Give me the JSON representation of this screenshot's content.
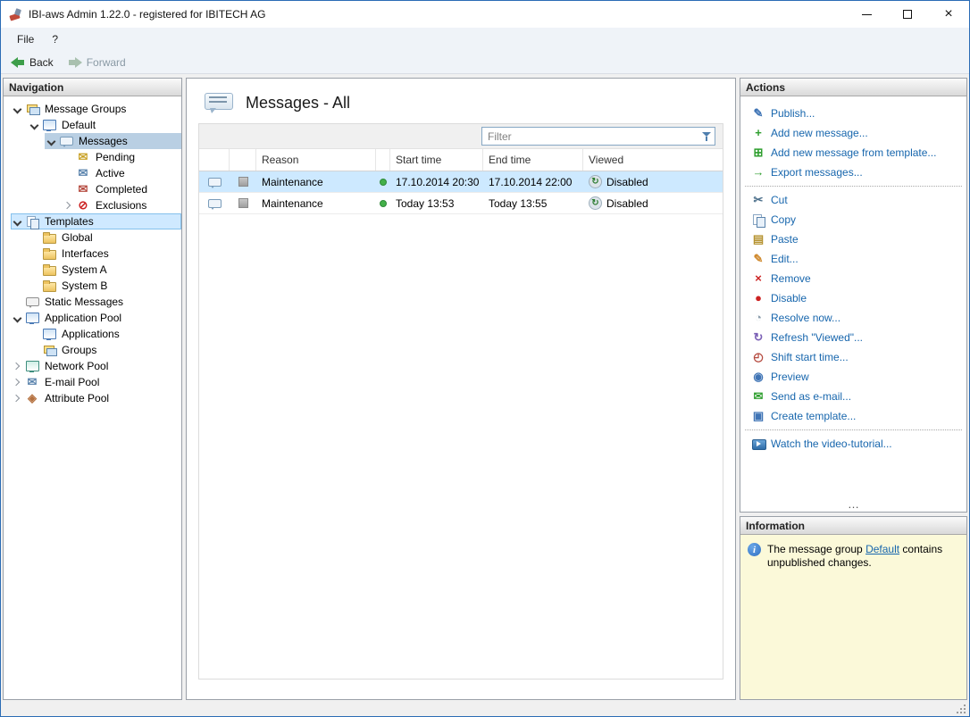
{
  "window": {
    "title": "IBI-aws Admin 1.22.0 - registered for IBITECH AG"
  },
  "menubar": {
    "file": "File",
    "help": "?"
  },
  "toolbar": {
    "back_label": "Back",
    "forward_label": "Forward"
  },
  "navigation": {
    "header": "Navigation",
    "tree": [
      {
        "label": "Message Groups",
        "level": 0,
        "icon": "message-groups-icon",
        "chevron": "expanded",
        "state": "none"
      },
      {
        "label": "Default",
        "level": 1,
        "icon": "default-group-icon",
        "chevron": "expanded",
        "state": "none"
      },
      {
        "label": "Messages",
        "level": 2,
        "icon": "messages-icon",
        "chevron": "expanded",
        "state": "selected"
      },
      {
        "label": "Pending",
        "level": 3,
        "icon": "pending-icon",
        "chevron": "none",
        "state": "none"
      },
      {
        "label": "Active",
        "level": 3,
        "icon": "active-icon",
        "chevron": "none",
        "state": "none"
      },
      {
        "label": "Completed",
        "level": 3,
        "icon": "completed-icon",
        "chevron": "none",
        "state": "none"
      },
      {
        "label": "Exclusions",
        "level": 3,
        "icon": "exclusions-icon",
        "chevron": "collapsed",
        "state": "none"
      },
      {
        "label": "Templates",
        "level": 0,
        "icon": "templates-icon",
        "chevron": "expanded",
        "state": "highlighted"
      },
      {
        "label": "Global",
        "level": 1,
        "icon": "folder-icon",
        "chevron": "none",
        "state": "none"
      },
      {
        "label": "Interfaces",
        "level": 1,
        "icon": "folder-icon",
        "chevron": "none",
        "state": "none"
      },
      {
        "label": "System A",
        "level": 1,
        "icon": "folder-icon",
        "chevron": "none",
        "state": "none"
      },
      {
        "label": "System B",
        "level": 1,
        "icon": "folder-icon",
        "chevron": "none",
        "state": "none"
      },
      {
        "label": "Static Messages",
        "level": 0,
        "icon": "static-messages-icon",
        "chevron": "none",
        "state": "none"
      },
      {
        "label": "Application Pool",
        "level": 0,
        "icon": "application-pool-icon",
        "chevron": "expanded",
        "state": "none"
      },
      {
        "label": "Applications",
        "level": 1,
        "icon": "applications-icon",
        "chevron": "none",
        "state": "none"
      },
      {
        "label": "Groups",
        "level": 1,
        "icon": "groups-icon",
        "chevron": "none",
        "state": "none"
      },
      {
        "label": "Network Pool",
        "level": 0,
        "icon": "network-pool-icon",
        "chevron": "collapsed",
        "state": "none"
      },
      {
        "label": "E-mail Pool",
        "level": 0,
        "icon": "email-pool-icon",
        "chevron": "collapsed",
        "state": "none"
      },
      {
        "label": "Attribute Pool",
        "level": 0,
        "icon": "attribute-pool-icon",
        "chevron": "collapsed",
        "state": "none"
      }
    ]
  },
  "main": {
    "title": "Messages - All",
    "filter": {
      "placeholder": "Filter"
    },
    "table": {
      "columns": [
        "",
        "",
        "Reason",
        "",
        "Start time",
        "End time",
        "Viewed"
      ],
      "rows": [
        {
          "reason": "Maintenance",
          "start": "17.10.2014 20:30",
          "end": "17.10.2014 22:00",
          "viewed": "Disabled",
          "selected": true
        },
        {
          "reason": "Maintenance",
          "start": "Today 13:53",
          "end": "Today 13:55",
          "viewed": "Disabled",
          "selected": false
        }
      ]
    }
  },
  "actions": {
    "header": "Actions",
    "overflow": "…",
    "items": [
      {
        "label": "Publish...",
        "icon": "publish-icon"
      },
      {
        "label": "Add new message...",
        "icon": "add-message-icon"
      },
      {
        "label": "Add new message from template...",
        "icon": "add-from-template-icon"
      },
      {
        "label": "Export messages...",
        "icon": "export-icon"
      },
      {
        "label": "Cut",
        "icon": "cut-icon",
        "separator_before": true
      },
      {
        "label": "Copy",
        "icon": "copy-icon"
      },
      {
        "label": "Paste",
        "icon": "paste-icon"
      },
      {
        "label": "Edit...",
        "icon": "edit-icon"
      },
      {
        "label": "Remove",
        "icon": "remove-icon"
      },
      {
        "label": "Disable",
        "icon": "disable-icon"
      },
      {
        "label": "Resolve now...",
        "icon": "resolve-icon"
      },
      {
        "label": "Refresh \"Viewed\"...",
        "icon": "refresh-viewed-icon"
      },
      {
        "label": "Shift start time...",
        "icon": "shift-start-icon"
      },
      {
        "label": "Preview",
        "icon": "preview-icon"
      },
      {
        "label": "Send as e-mail...",
        "icon": "send-email-icon"
      },
      {
        "label": "Create template...",
        "icon": "create-template-icon"
      },
      {
        "label": "Watch the video-tutorial...",
        "icon": "video-tutorial-icon",
        "separator_before": true
      }
    ]
  },
  "information": {
    "header": "Information",
    "text_before": "The message group ",
    "link": "Default",
    "text_after": " contains unpublished changes."
  },
  "icons": {
    "close-icon": {
      "glyph": "×"
    },
    "info-icon": {
      "glyph": "i"
    },
    "pending-icon": {
      "glyph": "✉",
      "color": "#c9a227"
    },
    "active-icon": {
      "glyph": "✉",
      "color": "#5b84ad"
    },
    "completed-icon": {
      "glyph": "✉",
      "color": "#b54a3f"
    },
    "exclusions-icon": {
      "glyph": "⊘",
      "color": "#cc2222"
    },
    "email-pool-icon": {
      "glyph": "✉",
      "color": "#5b84ad"
    },
    "attribute-pool-icon": {
      "glyph": "◈",
      "color": "#b5713f"
    },
    "publish-icon": {
      "glyph": "✎",
      "color": "#3f74b5"
    },
    "add-message-icon": {
      "glyph": "+",
      "color": "#2e9e2e"
    },
    "add-from-template-icon": {
      "glyph": "⊞",
      "color": "#2e9e2e"
    },
    "export-icon": {
      "glyph": "→",
      "color": "#2e9e2e"
    },
    "cut-icon": {
      "glyph": "✂",
      "color": "#4a6e8a"
    },
    "paste-icon": {
      "glyph": "▤",
      "color": "#b5922f"
    },
    "edit-icon": {
      "glyph": "✎",
      "color": "#d08a2e"
    },
    "remove-icon": {
      "glyph": "×",
      "color": "#cc2222"
    },
    "disable-icon": {
      "glyph": "●",
      "color": "#cc2222"
    },
    "resolve-icon": {
      "glyph": "◔",
      "color": "#8a9cab"
    },
    "refresh-viewed-icon": {
      "glyph": "↻",
      "color": "#7a5fb5"
    },
    "shift-start-icon": {
      "glyph": "◴",
      "color": "#b54a3f"
    },
    "preview-icon": {
      "glyph": "◉",
      "color": "#3f74b5"
    },
    "send-email-icon": {
      "glyph": "✉",
      "color": "#2e9e2e"
    },
    "create-template-icon": {
      "glyph": "▣",
      "color": "#3f74b5"
    },
    "viewed-disabled-icon": {
      "glyph": "↻",
      "color": "#2e7d32"
    }
  },
  "colors": {
    "window_border": "#2b6cb5",
    "action_link": "#1766ad",
    "row_selected": "#cde9ff",
    "tree_selected": "#b9cfe3",
    "tree_highlight": "#cfe9ff",
    "info_background": "#fbf9d9",
    "status_green": "#43b049",
    "disabled_red": "#cc2222"
  }
}
